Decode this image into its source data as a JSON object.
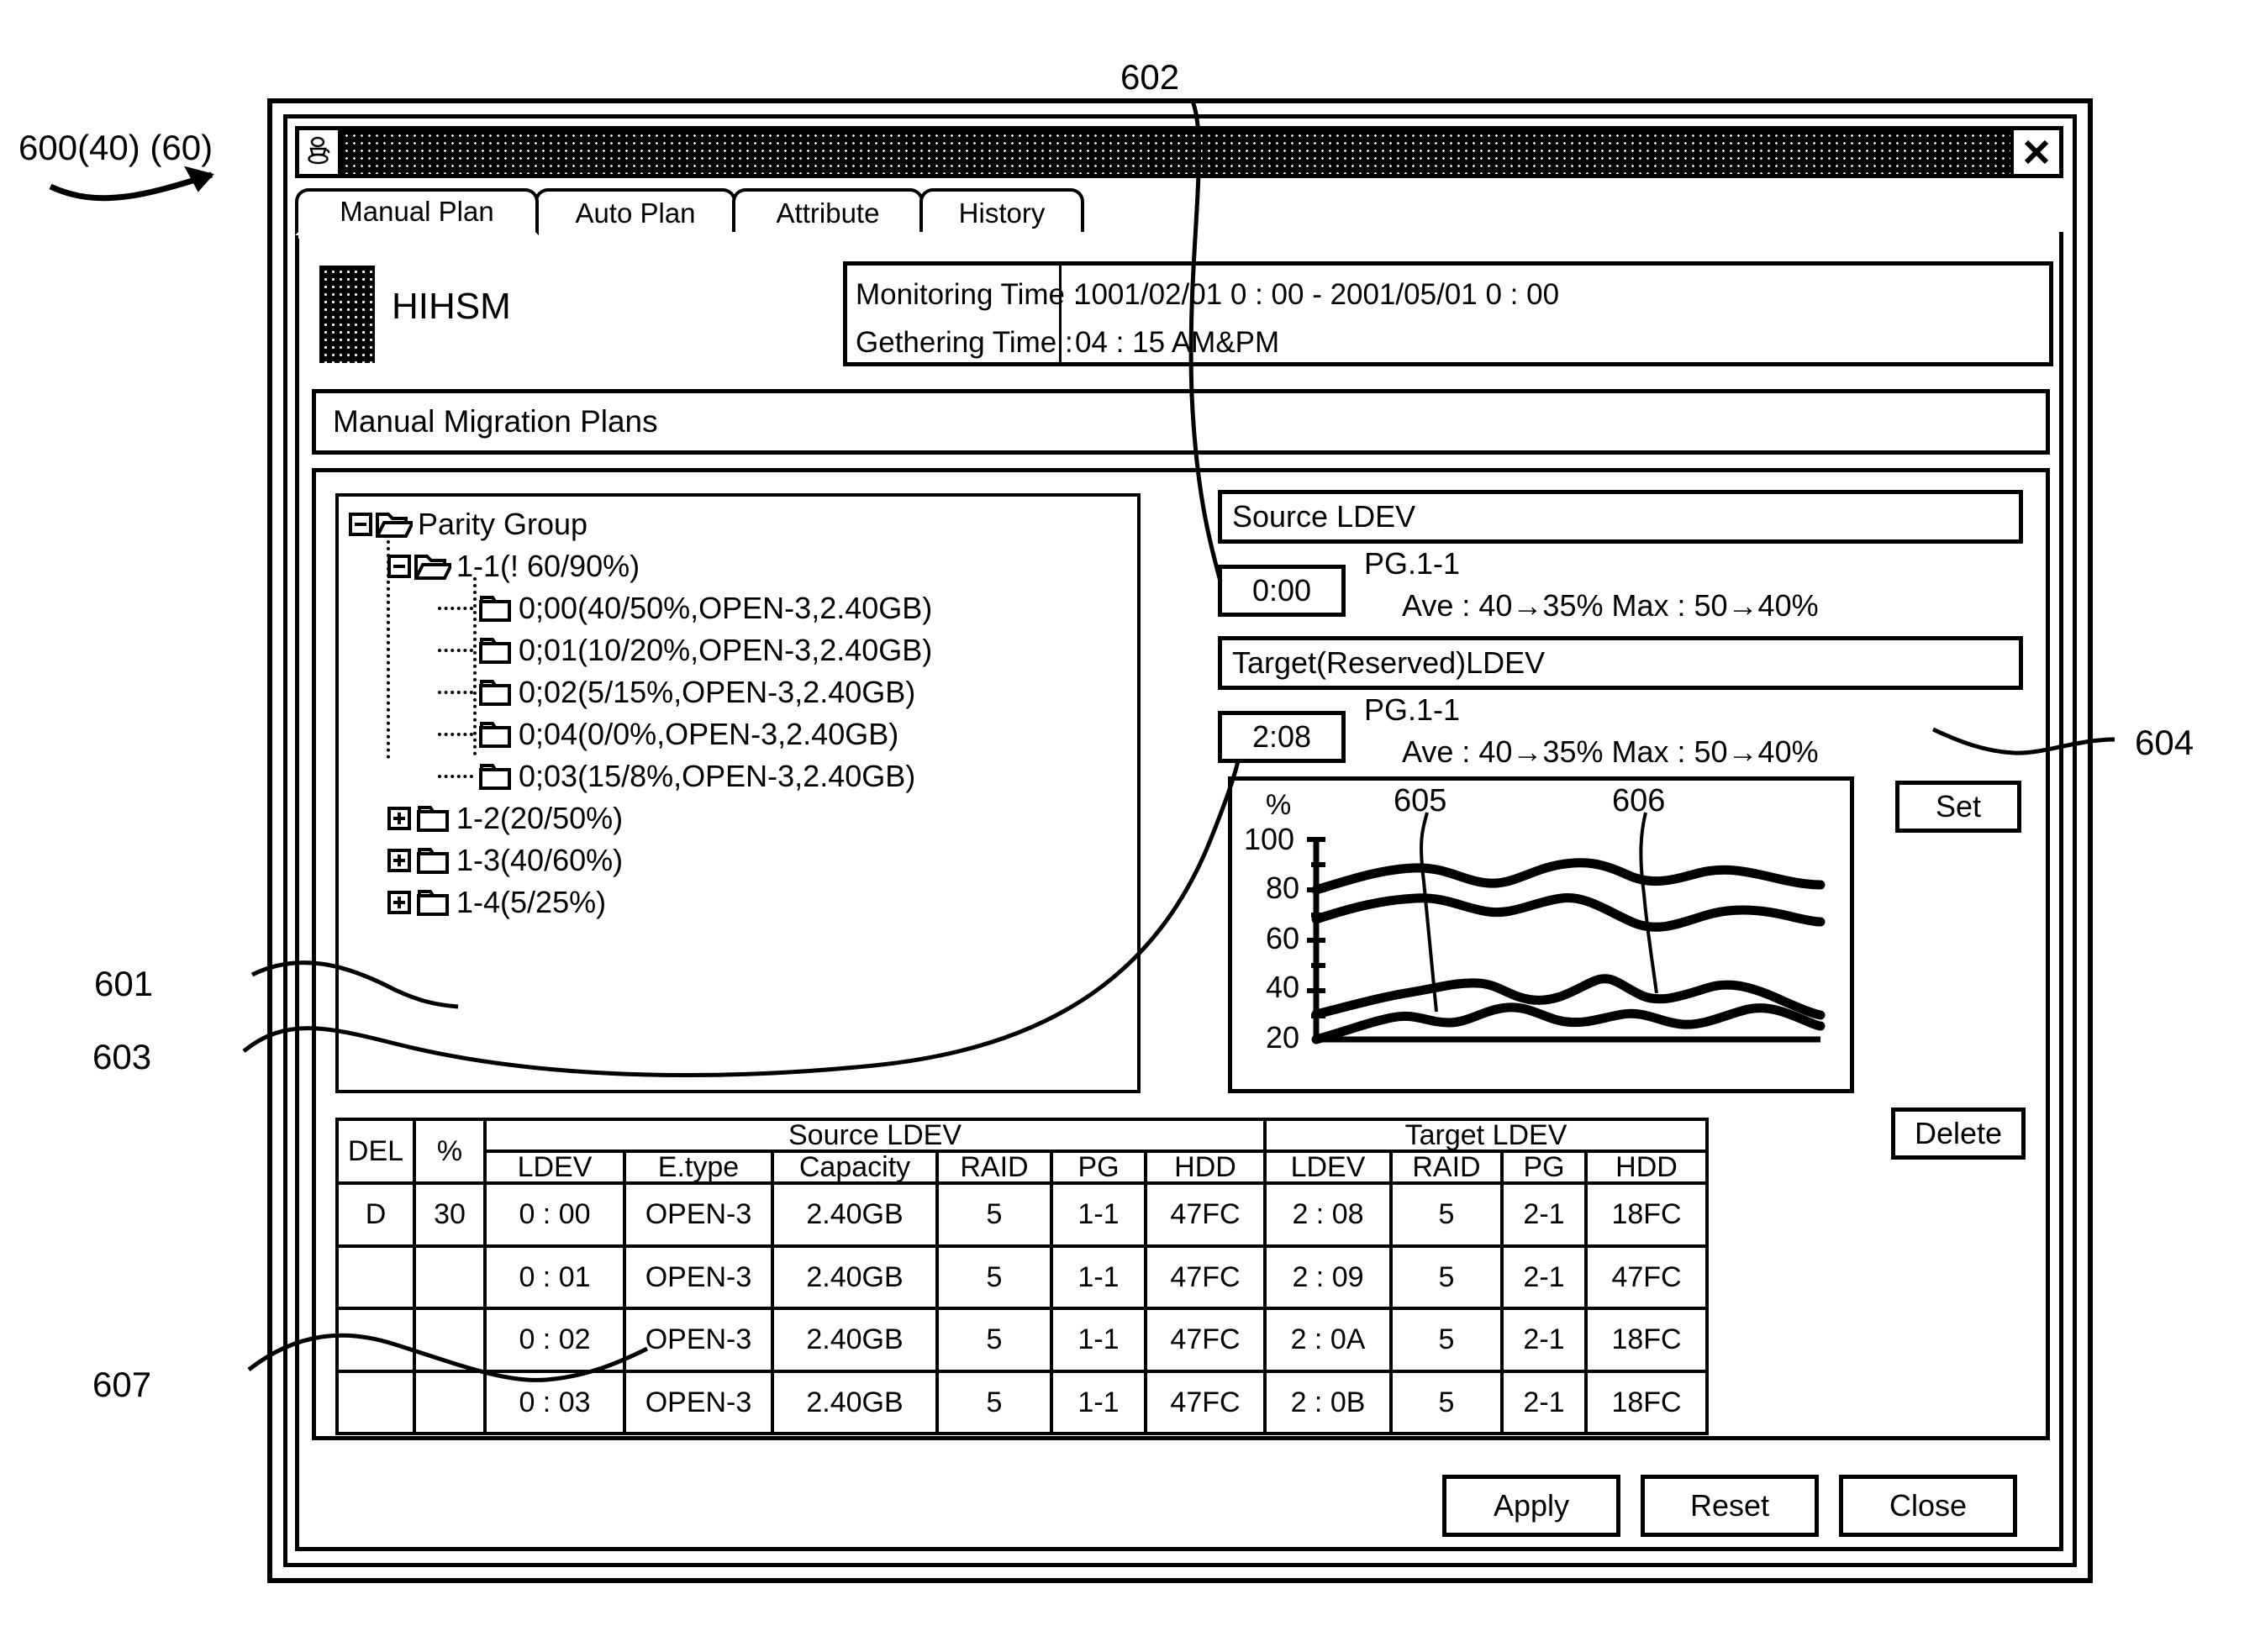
{
  "window": {
    "icon": "coffee-cup-icon",
    "close_label": "X"
  },
  "tabs": [
    {
      "label": "Manual Plan",
      "active": true
    },
    {
      "label": "Auto Plan",
      "active": false
    },
    {
      "label": "Attribute",
      "active": false
    },
    {
      "label": "History",
      "active": false
    }
  ],
  "header": {
    "app_name": "HIHSM",
    "monitoring_label": "Monitoring Time :",
    "gethering_label": "Gethering Time :",
    "monitoring_value": "1001/02/01  0 : 00  -  2001/05/01  0 : 00",
    "gethering_value": "04 : 15 AM&PM"
  },
  "section": {
    "title": "Manual Migration Plans"
  },
  "tree": {
    "root": "Parity Group",
    "nodes": [
      {
        "label": "1-1(! 60/90%)",
        "state": "expanded",
        "level": 1
      },
      {
        "label": "0;00(40/50%,OPEN-3,2.40GB)",
        "state": "leaf",
        "level": 2
      },
      {
        "label": "0;01(10/20%,OPEN-3,2.40GB)",
        "state": "leaf",
        "level": 2
      },
      {
        "label": "0;02(5/15%,OPEN-3,2.40GB)",
        "state": "leaf",
        "level": 2
      },
      {
        "label": "0;04(0/0%,OPEN-3,2.40GB)",
        "state": "leaf",
        "level": 2
      },
      {
        "label": "0;03(15/8%,OPEN-3,2.40GB)",
        "state": "leaf",
        "level": 2
      },
      {
        "label": "1-2(20/50%)",
        "state": "collapsed",
        "level": 1
      },
      {
        "label": "1-3(40/60%)",
        "state": "collapsed",
        "level": 1
      },
      {
        "label": "1-4(5/25%)",
        "state": "collapsed",
        "level": 1
      }
    ]
  },
  "source": {
    "bar_label": "Source LDEV",
    "time": "0:00",
    "pg": "PG.1-1",
    "stats": "Ave : 40→35%   Max : 50→40%"
  },
  "target": {
    "bar_label": "Target(Reserved)LDEV",
    "time": "2:08",
    "pg": "PG.1-1",
    "stats": "Ave : 40→35%   Max : 50→40%"
  },
  "buttons": {
    "set": "Set",
    "delete": "Delete",
    "apply": "Apply",
    "reset": "Reset",
    "close": "Close"
  },
  "table": {
    "group_headers": {
      "del": "DEL",
      "pct": "%",
      "source": "Source LDEV",
      "target": "Target LDEV"
    },
    "sub_headers": {
      "source": [
        "LDEV",
        "E.type",
        "Capacity",
        "RAID",
        "PG",
        "HDD"
      ],
      "target": [
        "LDEV",
        "RAID",
        "PG",
        "HDD"
      ]
    },
    "rows": [
      {
        "del": "D",
        "pct": "30",
        "s_ldev": "0 : 00",
        "s_etype": "OPEN-3",
        "s_cap": "2.40GB",
        "s_raid": "5",
        "s_pg": "1-1",
        "s_hdd": "47FC",
        "t_ldev": "2 : 08",
        "t_raid": "5",
        "t_pg": "2-1",
        "t_hdd": "18FC"
      },
      {
        "del": "",
        "pct": "",
        "s_ldev": "0 : 01",
        "s_etype": "OPEN-3",
        "s_cap": "2.40GB",
        "s_raid": "5",
        "s_pg": "1-1",
        "s_hdd": "47FC",
        "t_ldev": "2 : 09",
        "t_raid": "5",
        "t_pg": "2-1",
        "t_hdd": "47FC"
      },
      {
        "del": "",
        "pct": "",
        "s_ldev": "0 : 02",
        "s_etype": "OPEN-3",
        "s_cap": "2.40GB",
        "s_raid": "5",
        "s_pg": "1-1",
        "s_hdd": "47FC",
        "t_ldev": "2 : 0A",
        "t_raid": "5",
        "t_pg": "2-1",
        "t_hdd": "18FC"
      },
      {
        "del": "",
        "pct": "",
        "s_ldev": "0 : 03",
        "s_etype": "OPEN-3",
        "s_cap": "2.40GB",
        "s_raid": "5",
        "s_pg": "1-1",
        "s_hdd": "47FC",
        "t_ldev": "2 : 0B",
        "t_raid": "5",
        "t_pg": "2-1",
        "t_hdd": "18FC"
      }
    ]
  },
  "callouts": {
    "c600": "600(40) (60)",
    "c601": "601",
    "c602": "602",
    "c603": "603",
    "c604": "604",
    "c607": "607",
    "c605": "605",
    "c606": "606"
  },
  "chart_data": {
    "type": "line",
    "title": "",
    "xlabel": "",
    "ylabel": "%",
    "ylim": [
      20,
      100
    ],
    "yticks": [
      20,
      40,
      60,
      80,
      100
    ],
    "grid": false,
    "legend": "none",
    "annotations": [
      "605",
      "606"
    ],
    "series": [
      {
        "name": "upper-source",
        "values": [
          80,
          86,
          88,
          85,
          83,
          86,
          89,
          88,
          84,
          83,
          86,
          85,
          83,
          82
        ]
      },
      {
        "name": "upper-target",
        "values": [
          70,
          74,
          76,
          75,
          73,
          75,
          78,
          77,
          72,
          68,
          70,
          73,
          72,
          69
        ]
      },
      {
        "name": "lower-source",
        "values": [
          26,
          33,
          38,
          42,
          45,
          41,
          40,
          43,
          48,
          42,
          39,
          42,
          45,
          38,
          33
        ]
      },
      {
        "name": "lower-target",
        "values": [
          20,
          25,
          30,
          32,
          29,
          28,
          32,
          35,
          33,
          30,
          32,
          29,
          31,
          33,
          30,
          27
        ]
      }
    ]
  }
}
